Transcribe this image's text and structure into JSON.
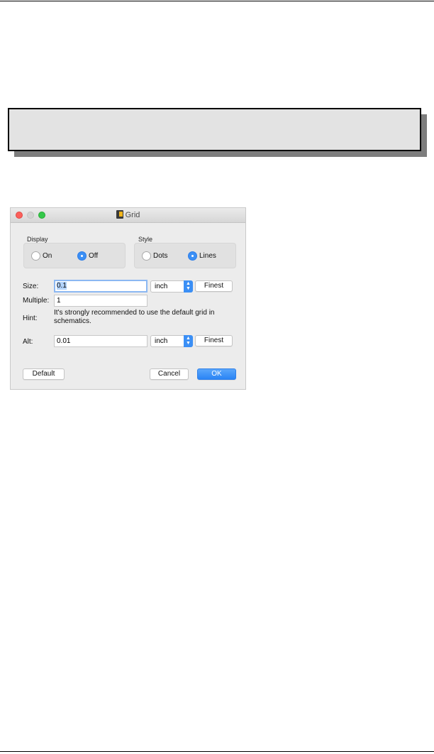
{
  "dialog": {
    "title": "Grid",
    "display": {
      "label": "Display",
      "options": [
        "On",
        "Off"
      ],
      "selected": "Off"
    },
    "style": {
      "label": "Style",
      "options": [
        "Dots",
        "Lines"
      ],
      "selected": "Lines"
    },
    "size": {
      "label": "Size:",
      "value": "0.1",
      "unit": "inch",
      "finest_label": "Finest"
    },
    "multiple": {
      "label": "Multiple:",
      "value": "1"
    },
    "hint": {
      "label": "Hint:",
      "text_line1": "It's strongly recommended to use the default grid in",
      "text_line2": "schematics."
    },
    "alt": {
      "label": "Alt:",
      "value": "0.01",
      "unit": "inch",
      "finest_label": "Finest"
    },
    "buttons": {
      "default": "Default",
      "cancel": "Cancel",
      "ok": "OK"
    }
  },
  "colors": {
    "accent": "#3b8ff5",
    "close": "#fc605b",
    "zoom": "#34c84a",
    "callout_fill": "#e3e3e3"
  }
}
